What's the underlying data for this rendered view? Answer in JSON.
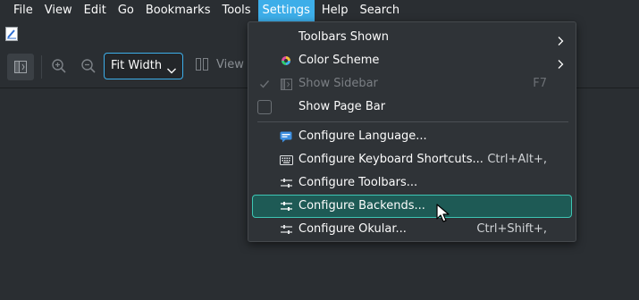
{
  "menubar": {
    "items": [
      "File",
      "View",
      "Edit",
      "Go",
      "Bookmarks",
      "Tools",
      "Settings",
      "Help",
      "Search"
    ],
    "active": "Settings"
  },
  "toolbar": {
    "zoom_value": "Fit Width",
    "view_mode_label": "View M"
  },
  "settings_menu": {
    "items": [
      {
        "label": "Toolbars Shown",
        "shortcut": "",
        "submenu": true
      },
      {
        "label": "Color Scheme",
        "shortcut": "",
        "submenu": true
      },
      {
        "label": "Show Sidebar",
        "shortcut": "F7",
        "disabled": true,
        "checked": true
      },
      {
        "label": "Show Page Bar",
        "shortcut": "",
        "checked": false
      },
      {
        "label": "Configure Language...",
        "shortcut": ""
      },
      {
        "label": "Configure Keyboard Shortcuts...",
        "shortcut": "Ctrl+Alt+,"
      },
      {
        "label": "Configure Toolbars...",
        "shortcut": ""
      },
      {
        "label": "Configure Backends...",
        "shortcut": "",
        "highlighted": true
      },
      {
        "label": "Configure Okular...",
        "shortcut": "Ctrl+Shift+,"
      }
    ]
  },
  "colors": {
    "accent": "#3daee9",
    "highlight_bg": "#1e5a55",
    "highlight_border": "#3ec6b4"
  }
}
